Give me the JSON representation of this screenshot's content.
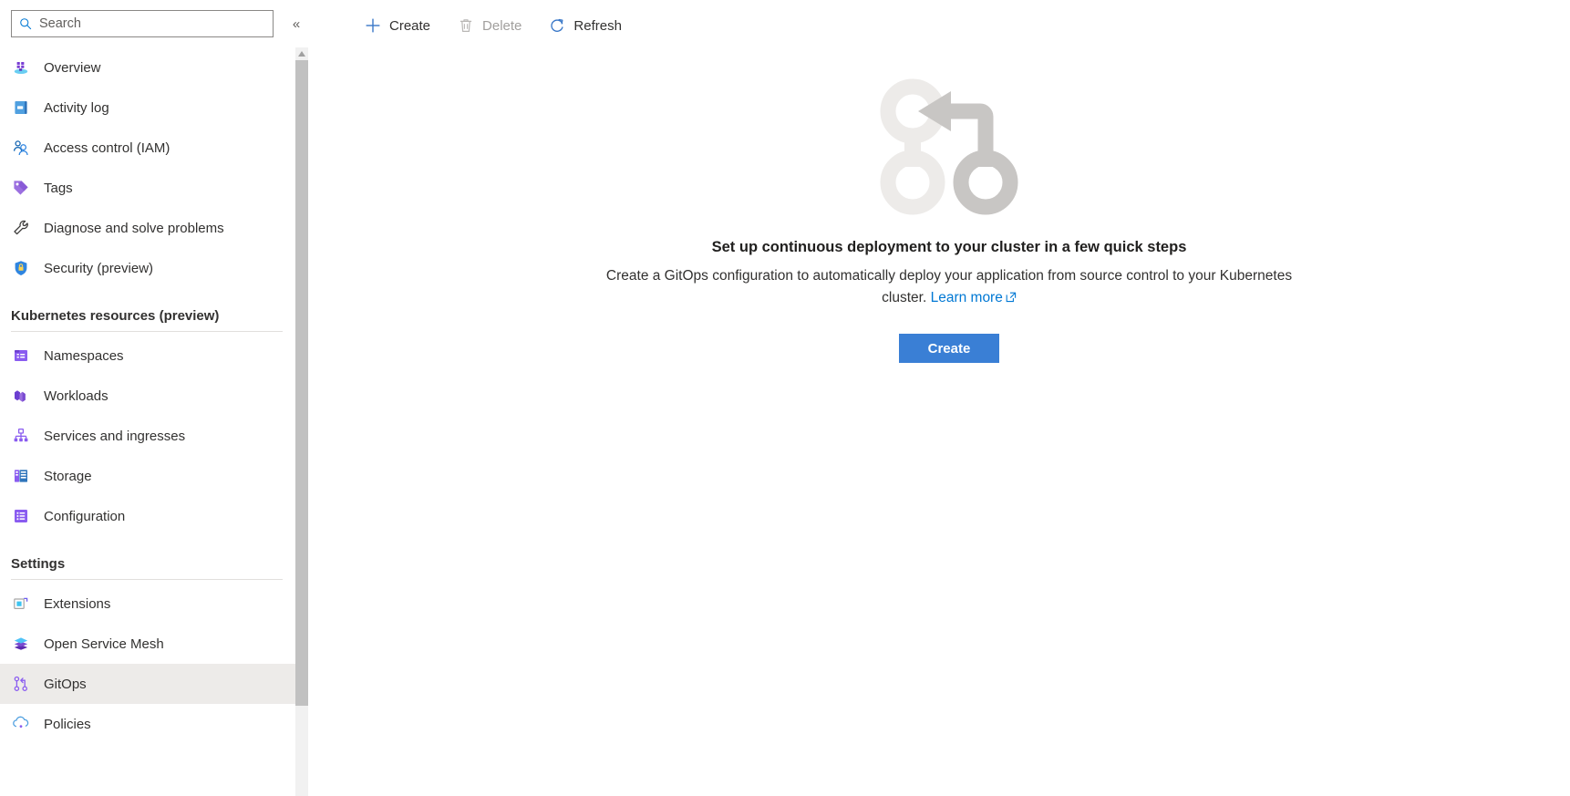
{
  "search": {
    "placeholder": "Search",
    "icon": "search-icon"
  },
  "collapse": {
    "label": "«",
    "icon": "chevron-double-left-icon"
  },
  "sidebar": {
    "items": [
      {
        "label": "Overview",
        "icon": "overview-icon",
        "selected": false
      },
      {
        "label": "Activity log",
        "icon": "activity-log-icon",
        "selected": false
      },
      {
        "label": "Access control (IAM)",
        "icon": "access-control-icon",
        "selected": false
      },
      {
        "label": "Tags",
        "icon": "tags-icon",
        "selected": false
      },
      {
        "label": "Diagnose and solve problems",
        "icon": "diagnose-icon",
        "selected": false
      },
      {
        "label": "Security (preview)",
        "icon": "security-icon",
        "selected": false
      }
    ],
    "groups": [
      {
        "title": "Kubernetes resources (preview)",
        "items": [
          {
            "label": "Namespaces",
            "icon": "namespaces-icon",
            "selected": false
          },
          {
            "label": "Workloads",
            "icon": "workloads-icon",
            "selected": false
          },
          {
            "label": "Services and ingresses",
            "icon": "services-ingresses-icon",
            "selected": false
          },
          {
            "label": "Storage",
            "icon": "storage-icon",
            "selected": false
          },
          {
            "label": "Configuration",
            "icon": "configuration-icon",
            "selected": false
          }
        ]
      },
      {
        "title": "Settings",
        "items": [
          {
            "label": "Extensions",
            "icon": "extensions-icon",
            "selected": false
          },
          {
            "label": "Open Service Mesh",
            "icon": "open-service-mesh-icon",
            "selected": false
          },
          {
            "label": "GitOps",
            "icon": "gitops-icon",
            "selected": true
          },
          {
            "label": "Policies",
            "icon": "policies-icon",
            "selected": false
          }
        ]
      }
    ]
  },
  "toolbar": {
    "create_label": "Create",
    "create_icon": "plus-icon",
    "delete_label": "Delete",
    "delete_icon": "trash-icon",
    "delete_disabled": true,
    "refresh_label": "Refresh",
    "refresh_icon": "refresh-icon"
  },
  "empty_state": {
    "illustration": "git-branch-merge-illustration",
    "title": "Set up continuous deployment to your cluster in a few quick steps",
    "description_part1": "Create a GitOps configuration to automatically deploy your application from source control to your Kubernetes cluster.",
    "learn_more_label": "Learn more",
    "learn_more_icon": "external-link-icon",
    "cta_label": "Create"
  },
  "colors": {
    "accent_blue": "#0078d4",
    "cta_blue": "#3a7fd5",
    "selected_row": "#edebe9",
    "illustration_light": "#edebe9",
    "illustration_dark": "#c8c6c4",
    "disabled_text": "#a19f9d",
    "scrollbar_thumb": "#c1c1c1"
  }
}
